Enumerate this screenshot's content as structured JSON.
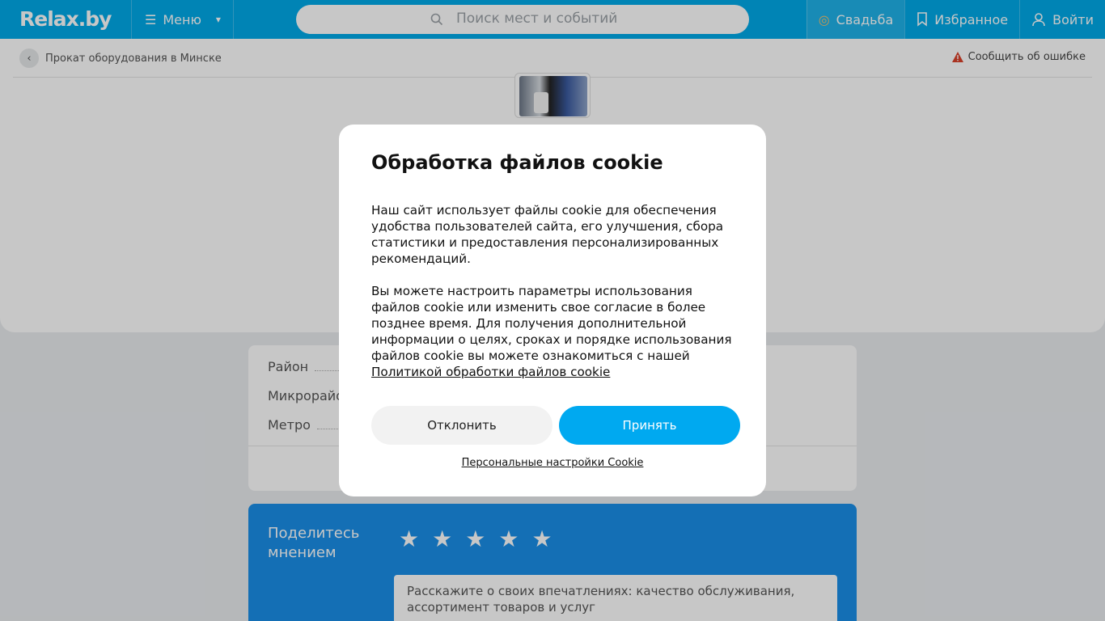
{
  "header": {
    "logo": "Relax.by",
    "menu_label": "Меню",
    "search_placeholder": "Поиск мест и событий",
    "wedding_label": "Свадьба",
    "favorites_label": "Избранное",
    "login_label": "Войти",
    "accent_color": "#00a9e8"
  },
  "breadcrumb": {
    "back_label": "Прокат оборудования в Минске"
  },
  "report_label": "Сообщить об ошибке",
  "info": {
    "district_label": "Район",
    "microdistrict_label": "Микрорайо",
    "metro_label": "Метро"
  },
  "review": {
    "title_line1": "Поделитесь",
    "title_line2": "мнением",
    "stars": 5,
    "textarea_placeholder": "Расскажите о своих впечатлениях: качество обслуживания, ассортимент товаров и услуг"
  },
  "cookie_modal": {
    "title": "Обработка файлов cookie",
    "paragraph1": "Наш сайт использует файлы cookie для обеспечения удобства пользователей сайта, его улучшения, сбора статистики и предоставления персонализированных рекомендаций.",
    "paragraph2": "Вы можете настроить параметры использования файлов cookie или изменить свое согласие в более позднее время. Для получения дополнительной информации о целях, сроках и порядке использования файлов cookie вы можете ознакомиться с нашей",
    "policy_link": "Политикой обработки файлов cookie",
    "decline_label": "Отклонить",
    "accept_label": "Принять",
    "personal_settings_label": "Персональные настройки Cookie",
    "accept_color": "#00a9f0"
  }
}
